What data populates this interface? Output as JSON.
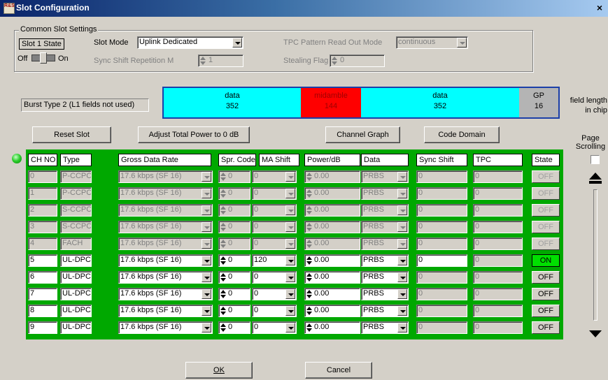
{
  "window": {
    "title": "Slot Configuration",
    "close": "×",
    "app_icon": "app-icon"
  },
  "common": {
    "legend": "Common Slot Settings",
    "slot_state_label": "Slot 1 State",
    "off": "Off",
    "on": "On",
    "slot_mode_label": "Slot Mode",
    "slot_mode_value": "Uplink Dedicated",
    "sync_shift_label": "Sync Shift Repetition M",
    "sync_shift_value": "1",
    "tpc_label": "TPC Pattern Read Out Mode",
    "tpc_value": "continuous",
    "stealing_label": "Stealing Flag",
    "stealing_value": "0"
  },
  "burst": {
    "type_label": "Burst Type 2 (L1 fields not used)",
    "field_length_label": "field length in chip",
    "segments": [
      {
        "name": "data",
        "value": "352",
        "color": "#00ffff"
      },
      {
        "name": "midamble",
        "value": "144",
        "color": "#ff0000"
      },
      {
        "name": "data",
        "value": "352",
        "color": "#00ffff"
      },
      {
        "name": "GP",
        "value": "16",
        "color": "#b4b4b4"
      }
    ]
  },
  "buttons": {
    "reset": "Reset Slot",
    "adjust": "Adjust Total Power to 0 dB",
    "channel_graph": "Channel Graph",
    "code_domain": "Code Domain",
    "ok": "OK",
    "cancel": "Cancel"
  },
  "page_scrolling": {
    "label": "Page Scrolling"
  },
  "table": {
    "headers": [
      "CH NO",
      "Type",
      "Gross Data Rate",
      "Spr. Code",
      "MA Shift",
      "Power/dB",
      "Data",
      "Sync Shift",
      "TPC",
      "State"
    ],
    "rows": [
      {
        "ch": "0",
        "type": "P-CCPCH",
        "rate": "17.6 kbps (SF 16)",
        "spr": "0",
        "ma": "0",
        "power": "0.00",
        "data": "PRBS",
        "sync": "0",
        "tpc": "0",
        "state": "OFF",
        "enabled": false,
        "ma_enabled": false
      },
      {
        "ch": "1",
        "type": "P-CCPCH",
        "rate": "17.6 kbps (SF 16)",
        "spr": "0",
        "ma": "0",
        "power": "0.00",
        "data": "PRBS",
        "sync": "0",
        "tpc": "0",
        "state": "OFF",
        "enabled": false,
        "ma_enabled": false
      },
      {
        "ch": "2",
        "type": "S-CCPCH",
        "rate": "17.6 kbps (SF 16)",
        "spr": "0",
        "ma": "0",
        "power": "0.00",
        "data": "PRBS",
        "sync": "0",
        "tpc": "0",
        "state": "OFF",
        "enabled": false,
        "ma_enabled": false
      },
      {
        "ch": "3",
        "type": "S-CCPCH",
        "rate": "17.6 kbps (SF 16)",
        "spr": "0",
        "ma": "0",
        "power": "0.00",
        "data": "PRBS",
        "sync": "0",
        "tpc": "0",
        "state": "OFF",
        "enabled": false,
        "ma_enabled": false
      },
      {
        "ch": "4",
        "type": "FACH",
        "rate": "17.6 kbps (SF 16)",
        "spr": "0",
        "ma": "0",
        "power": "0.00",
        "data": "PRBS",
        "sync": "0",
        "tpc": "0",
        "state": "OFF",
        "enabled": false,
        "ma_enabled": false
      },
      {
        "ch": "5",
        "type": "UL-DPCH",
        "rate": "17.6 kbps (SF 16)",
        "spr": "0",
        "ma": "120",
        "power": "0.00",
        "data": "PRBS",
        "sync": "0",
        "tpc": "0",
        "state": "ON",
        "enabled": true,
        "ma_enabled": true
      },
      {
        "ch": "6",
        "type": "UL-DPCH",
        "rate": "17.6 kbps (SF 16)",
        "spr": "0",
        "ma": "0",
        "power": "0.00",
        "data": "PRBS",
        "sync": "0",
        "tpc": "0",
        "state": "OFF",
        "enabled": true,
        "ma_enabled": true
      },
      {
        "ch": "7",
        "type": "UL-DPCH",
        "rate": "17.6 kbps (SF 16)",
        "spr": "0",
        "ma": "0",
        "power": "0.00",
        "data": "PRBS",
        "sync": "0",
        "tpc": "0",
        "state": "OFF",
        "enabled": true,
        "ma_enabled": true
      },
      {
        "ch": "8",
        "type": "UL-DPCH",
        "rate": "17.6 kbps (SF 16)",
        "spr": "0",
        "ma": "0",
        "power": "0.00",
        "data": "PRBS",
        "sync": "0",
        "tpc": "0",
        "state": "OFF",
        "enabled": true,
        "ma_enabled": true
      },
      {
        "ch": "9",
        "type": "UL-DPCH",
        "rate": "17.6 kbps (SF 16)",
        "spr": "0",
        "ma": "0",
        "power": "0.00",
        "data": "PRBS",
        "sync": "0",
        "tpc": "0",
        "state": "OFF",
        "enabled": true,
        "ma_enabled": true
      }
    ]
  }
}
